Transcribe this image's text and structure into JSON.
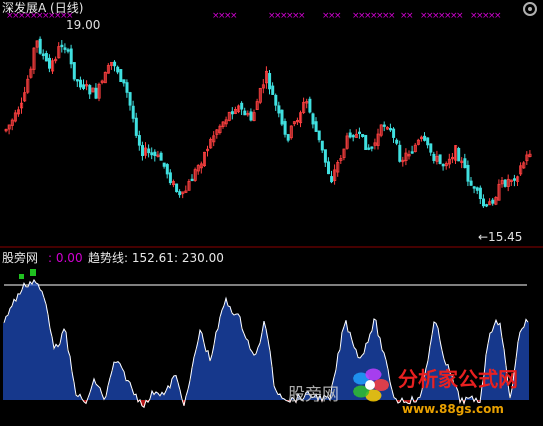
{
  "main": {
    "title": "深发展A (日线)",
    "high_label": "19.00",
    "low_label": "←15.45"
  },
  "indicator": {
    "name": "股旁网",
    "value": ": 0.00",
    "trend_label": "趋势线: 152.61",
    "trend_value2": ": 230.00"
  },
  "watermark": {
    "text": "股旁网",
    "brand": "分析家公式网",
    "url": "www.88gs.com"
  },
  "colors": {
    "up": "#ff4040",
    "down": "#40e0e0",
    "hist": "#2050c8",
    "hist_neg": "#ff2020",
    "line": "#ffffff",
    "marker": "#d000d0",
    "flag": "#20c020"
  }
}
